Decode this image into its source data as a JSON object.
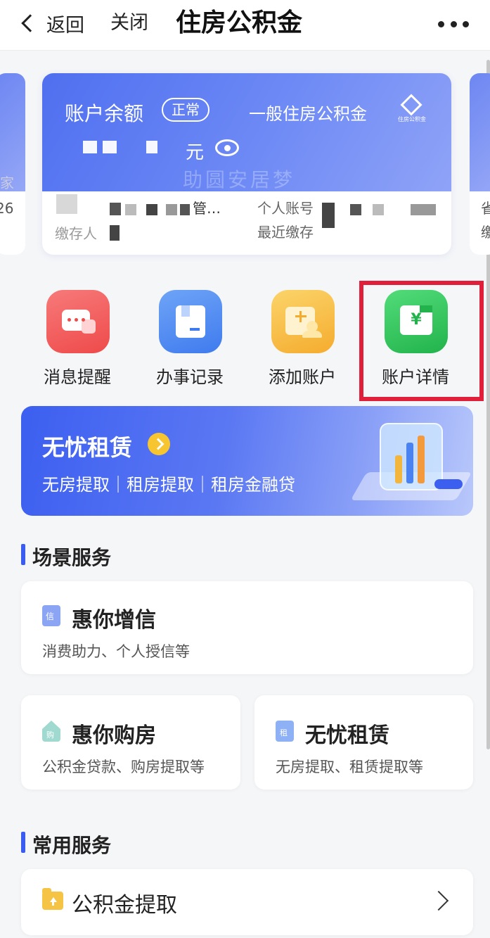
{
  "nav": {
    "back_label": "返回",
    "close_label": "关闭",
    "title": "住房公积金"
  },
  "account_card": {
    "balance_label": "账户余额",
    "status_badge": "正常",
    "account_type": "一般住房公积金",
    "logo_text": "住房公积金",
    "balance_unit": "元",
    "slogan": "助圆安居梦",
    "unit_partial": "管…",
    "payer_label": "缴存人",
    "personal_account_label": "个人账号",
    "last_paid_label": "最近缴存"
  },
  "peek_cards": {
    "left_text_1": "家",
    "left_text_2": "26",
    "right_text_1": "省",
    "right_text_2": "缴"
  },
  "quick_entries": [
    {
      "label": "消息提醒",
      "icon": "message-icon",
      "color": "#f05b5b"
    },
    {
      "label": "办事记录",
      "icon": "record-icon",
      "color": "#4a86f0"
    },
    {
      "label": "添加账户",
      "icon": "add-account-icon",
      "color": "#f6b93a"
    },
    {
      "label": "账户详情",
      "icon": "account-detail-icon",
      "color": "#2fc95a"
    }
  ],
  "banner": {
    "title": "无忧租赁",
    "subtitle": "无房提取｜租房提取｜租房金融贷"
  },
  "scene_services": {
    "heading": "场景服务",
    "items": [
      {
        "title": "惠你增信",
        "desc": "消费助力、个人授信等",
        "icon_char": "信"
      },
      {
        "title": "惠你购房",
        "desc": "公积金贷款、购房提取等",
        "icon_char": "购"
      },
      {
        "title": "无忧租赁",
        "desc": "无房提取、租赁提取等",
        "icon_char": "租"
      }
    ]
  },
  "common_services": {
    "heading": "常用服务",
    "items": [
      {
        "title": "公积金提取"
      }
    ]
  },
  "colors": {
    "brand_blue": "#3b5cf0",
    "highlight_red": "#e0203a"
  }
}
